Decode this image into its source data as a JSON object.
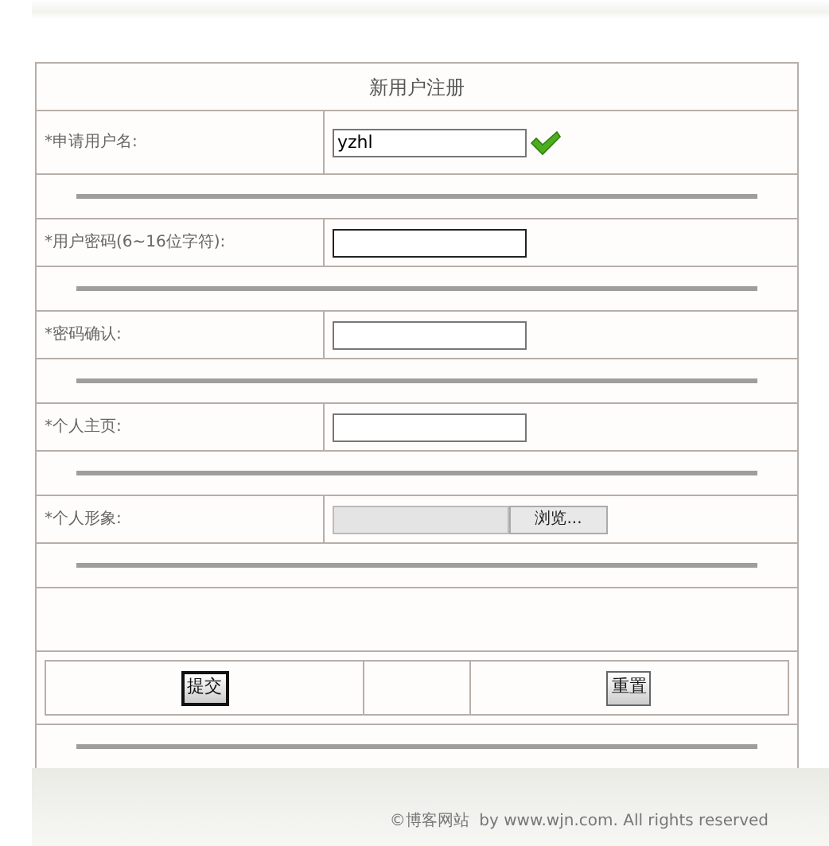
{
  "form": {
    "title": "新用户注册",
    "fields": [
      {
        "kind": "text",
        "label": "*申请用户名:",
        "value": "yzhl",
        "valid": true
      },
      {
        "kind": "password",
        "label": "*用户密码(6~16位字符):",
        "valid": false
      },
      {
        "kind": "password",
        "label": "*密码确认:",
        "valid": false
      },
      {
        "kind": "text",
        "label": "*个人主页:",
        "valid": false
      },
      {
        "kind": "file",
        "label": "*个人形象:",
        "browse": "浏览..."
      }
    ],
    "buttons": [
      {
        "label": "提交",
        "focused": true
      },
      {
        "label": "重置",
        "focused": false
      }
    ]
  },
  "footer": {
    "text": "©博客网站  by www.wjn.com. All rights reserved"
  }
}
